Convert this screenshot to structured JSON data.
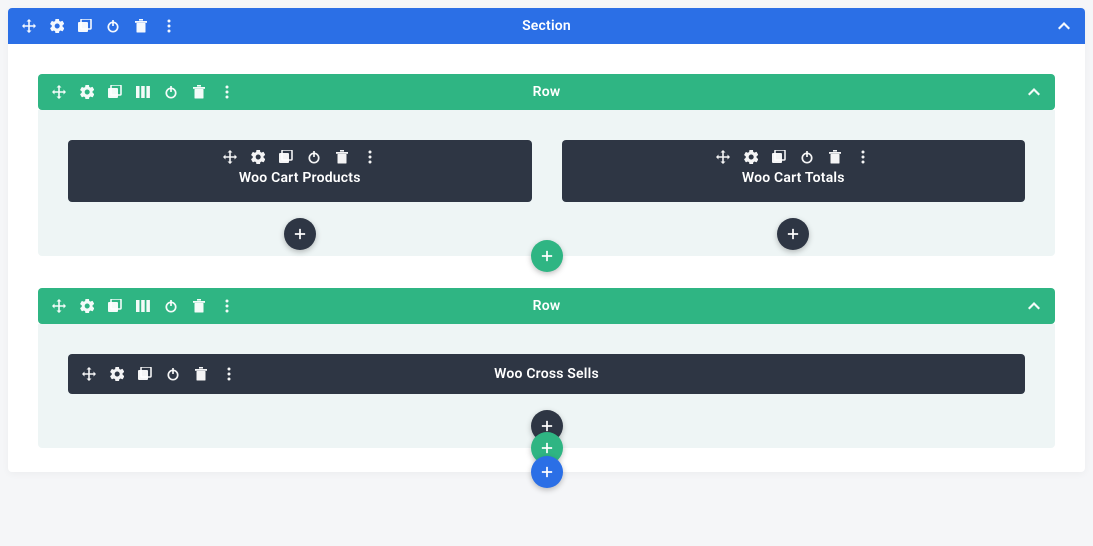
{
  "colors": {
    "section_bg": "#2b6fe6",
    "row_bg": "#2fb583",
    "module_bg": "#2e3644",
    "add_dark": "#2e3644",
    "add_green": "#2fb583",
    "add_blue": "#2b6fe6"
  },
  "section": {
    "title": "Section",
    "toolbar_icons": [
      "move",
      "settings",
      "duplicate",
      "power",
      "delete",
      "more"
    ],
    "rows": [
      {
        "title": "Row",
        "toolbar_icons": [
          "move",
          "settings",
          "duplicate",
          "columns",
          "power",
          "delete",
          "more"
        ],
        "modules": [
          {
            "title": "Woo Cart Products",
            "toolbar_icons": [
              "move",
              "settings",
              "duplicate",
              "power",
              "delete",
              "more"
            ]
          },
          {
            "title": "Woo Cart Totals",
            "toolbar_icons": [
              "move",
              "settings",
              "duplicate",
              "power",
              "delete",
              "more"
            ]
          }
        ]
      },
      {
        "title": "Row",
        "toolbar_icons": [
          "move",
          "settings",
          "duplicate",
          "columns",
          "power",
          "delete",
          "more"
        ],
        "modules": [
          {
            "title": "Woo Cross Sells",
            "toolbar_icons": [
              "move",
              "settings",
              "duplicate",
              "power",
              "delete",
              "more"
            ]
          }
        ]
      }
    ]
  }
}
